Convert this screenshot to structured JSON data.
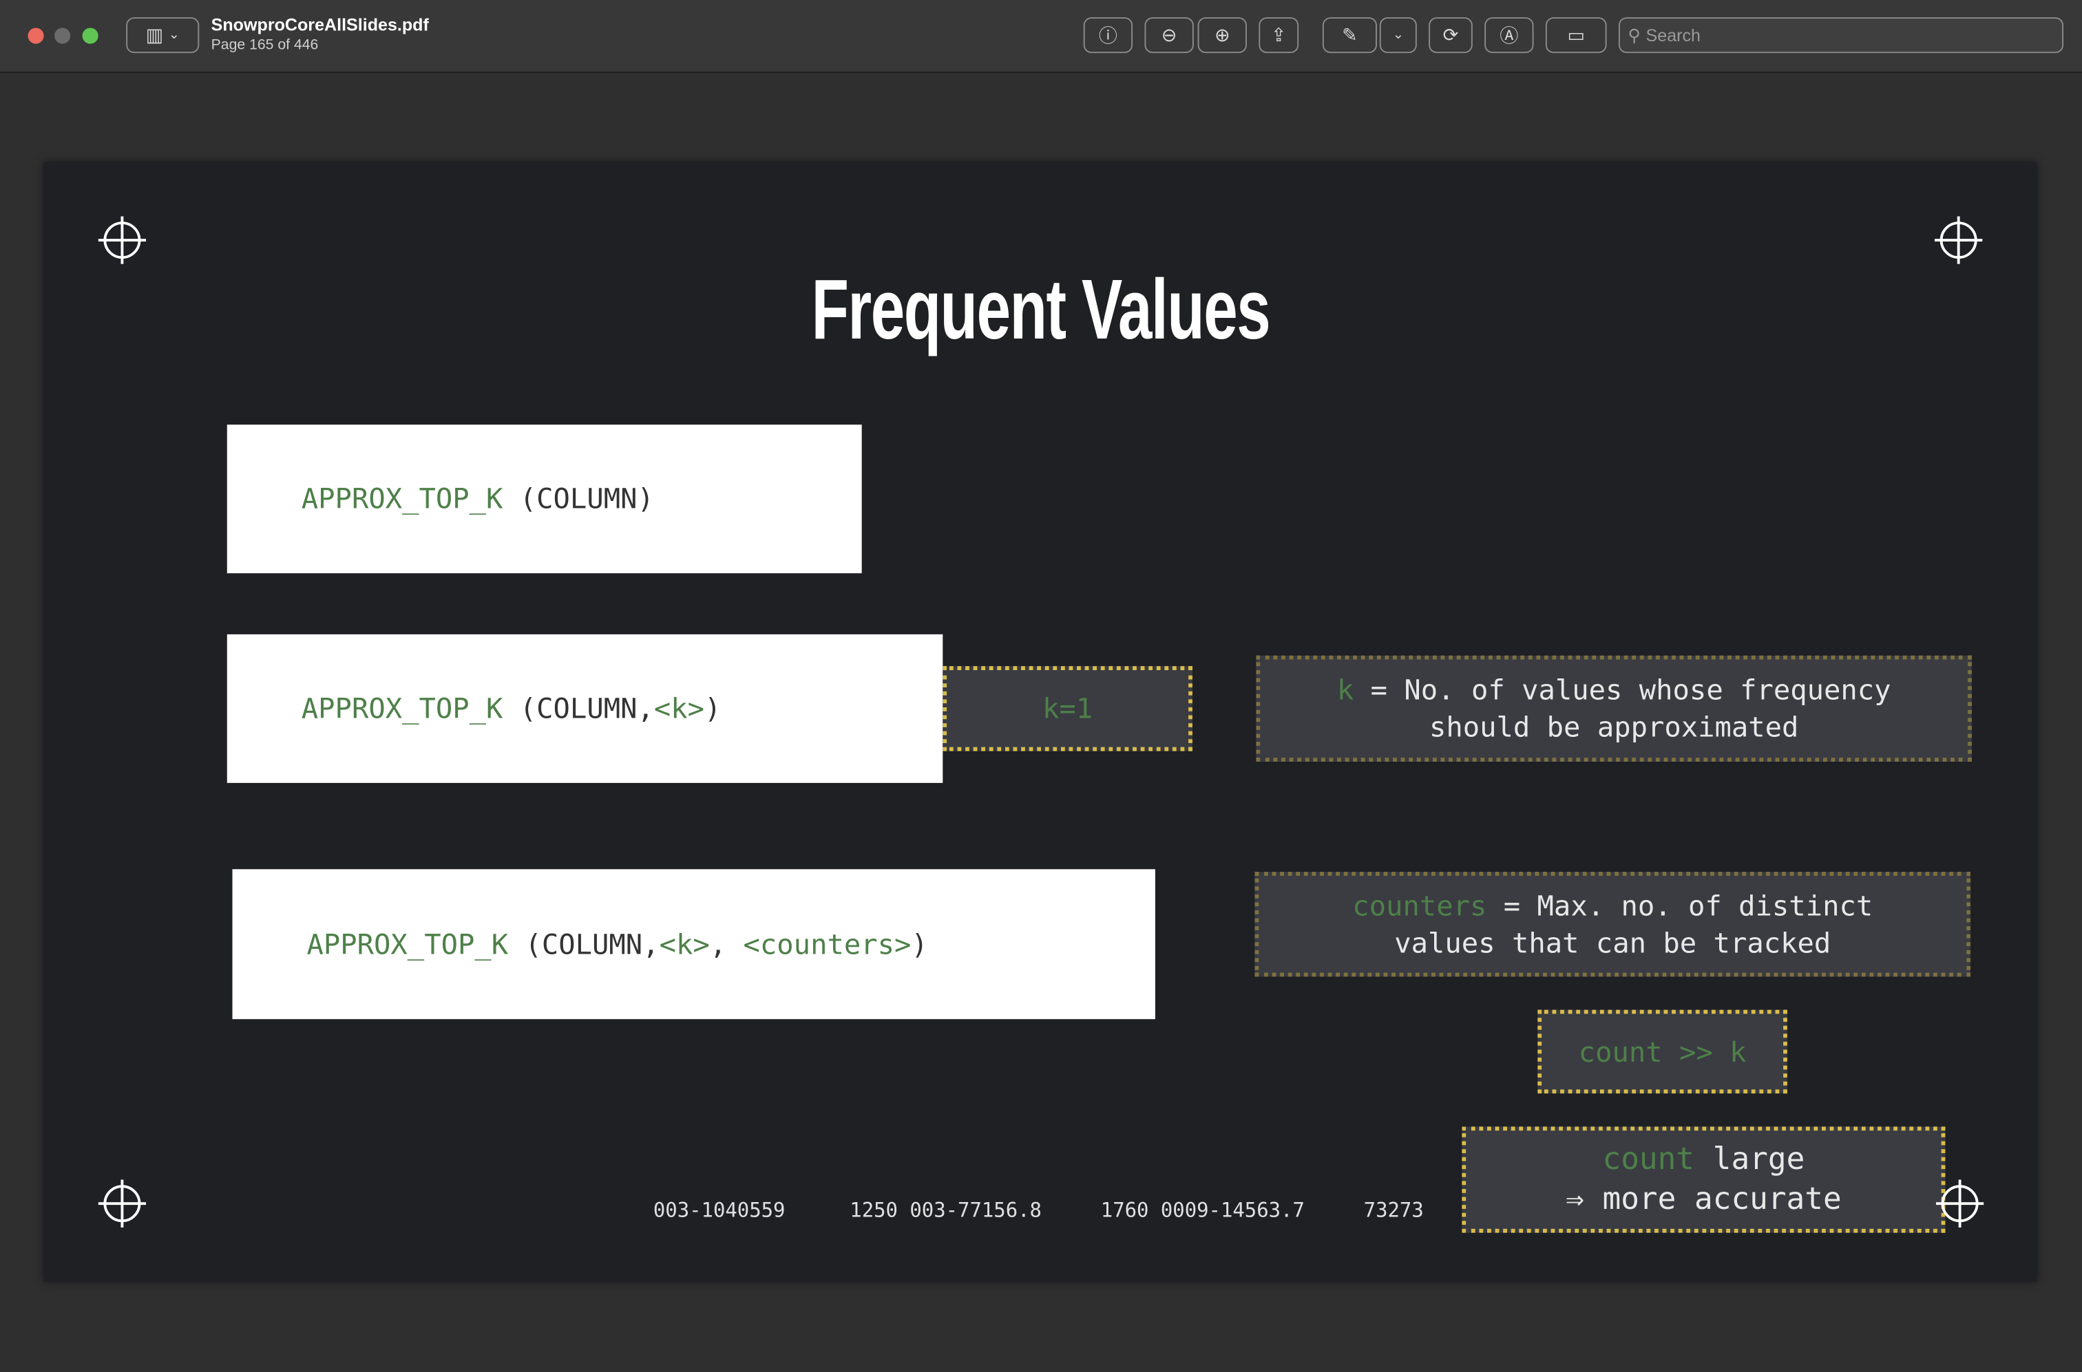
{
  "window": {
    "title": "SnowproCoreAllSlides.pdf",
    "page_info": "Page 165 of 446",
    "search_placeholder": "Search",
    "toolbar": [
      "info-icon",
      "zoom-out-icon",
      "zoom-in-icon",
      "share-icon",
      "highlight-pen-icon",
      "chevron-down-icon",
      "rotate-icon",
      "markup-icon",
      "form-fill-icon"
    ]
  },
  "slide": {
    "title": "Frequent Values",
    "code1": {
      "fn": "APPROX_TOP_K",
      "args": " (COLUMN)"
    },
    "code2": {
      "fn": "APPROX_TOP_K",
      "args": " (COLUMN,",
      "k": "<k>",
      "close": ")"
    },
    "code3": {
      "fn": "APPROX_TOP_K",
      "args": " (COLUMN,",
      "k": "<k>",
      "sep": ", ",
      "counters": "<counters>",
      "close": ")"
    },
    "k_example": "k=1",
    "k_note": {
      "term": "k",
      "line1": " = No. of values whose frequency",
      "line2": "should be approximated"
    },
    "counters_note": {
      "term": "counters",
      "line1": " = Max. no. of distinct",
      "line2": "values that can be tracked"
    },
    "count_k": "count >> k",
    "count_large": {
      "term": "count",
      "line1": " large",
      "line2": "⇒ more accurate"
    },
    "footer_numbers": [
      "003-1040559",
      "1250 003-77156.8",
      "1760 0009-14563.7",
      "73273"
    ]
  },
  "colors": {
    "accent_green": "#4e8049",
    "dotted_yellow": "#d9bd4c",
    "slide_bg": "#1f2024"
  }
}
